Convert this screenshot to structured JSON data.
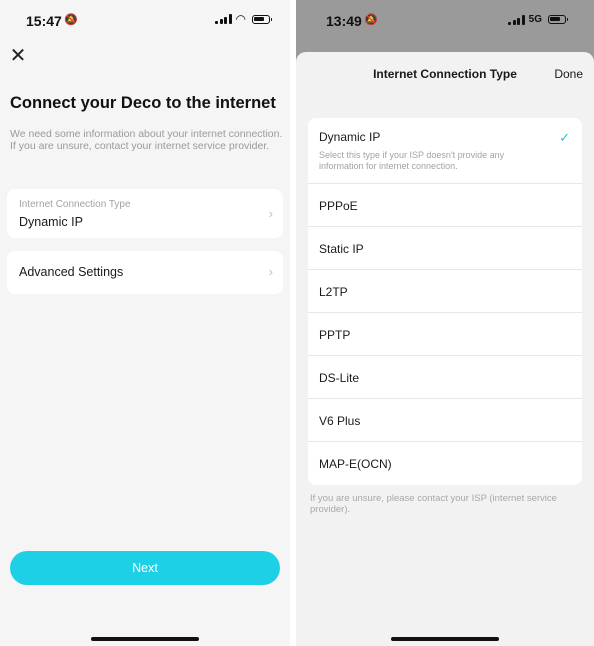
{
  "left": {
    "status_bar": {
      "time": "15:47",
      "mute_icon": "bell-slash-icon",
      "icons": [
        "signal-bars-icon",
        "wifi-icon",
        "battery-icon"
      ]
    },
    "close_icon": "close-icon",
    "title": "Connect your Deco to the internet",
    "description": "We need some information about your internet connection. If you are unsure, contact your internet service provider.",
    "connection_card": {
      "label": "Internet Connection Type",
      "value": "Dynamic IP",
      "chevron_icon": "chevron-right-icon"
    },
    "advanced_card": {
      "label": "Advanced Settings",
      "chevron_icon": "chevron-right-icon"
    },
    "next_button": "Next",
    "accent_color": "#1ed0e6"
  },
  "right": {
    "status_bar": {
      "time": "13:49",
      "mute_icon": "bell-slash-icon",
      "network": "5G",
      "icons": [
        "signal-bars-icon",
        "battery-icon"
      ]
    },
    "sheet": {
      "title": "Internet Connection Type",
      "done": "Done",
      "selected": "Dynamic IP",
      "check_icon": "checkmark-icon",
      "options": [
        {
          "label": "Dynamic IP",
          "sub": "Select this type if your ISP doesn't provide any information for internet connection."
        },
        {
          "label": "PPPoE"
        },
        {
          "label": "Static IP"
        },
        {
          "label": "L2TP"
        },
        {
          "label": "PPTP"
        },
        {
          "label": "DS-Lite"
        },
        {
          "label": "V6 Plus"
        },
        {
          "label": "MAP-E(OCN)"
        }
      ],
      "footer": "If you are unsure, please contact your ISP (internet service provider).",
      "check_color": "#1ec8dd"
    }
  }
}
